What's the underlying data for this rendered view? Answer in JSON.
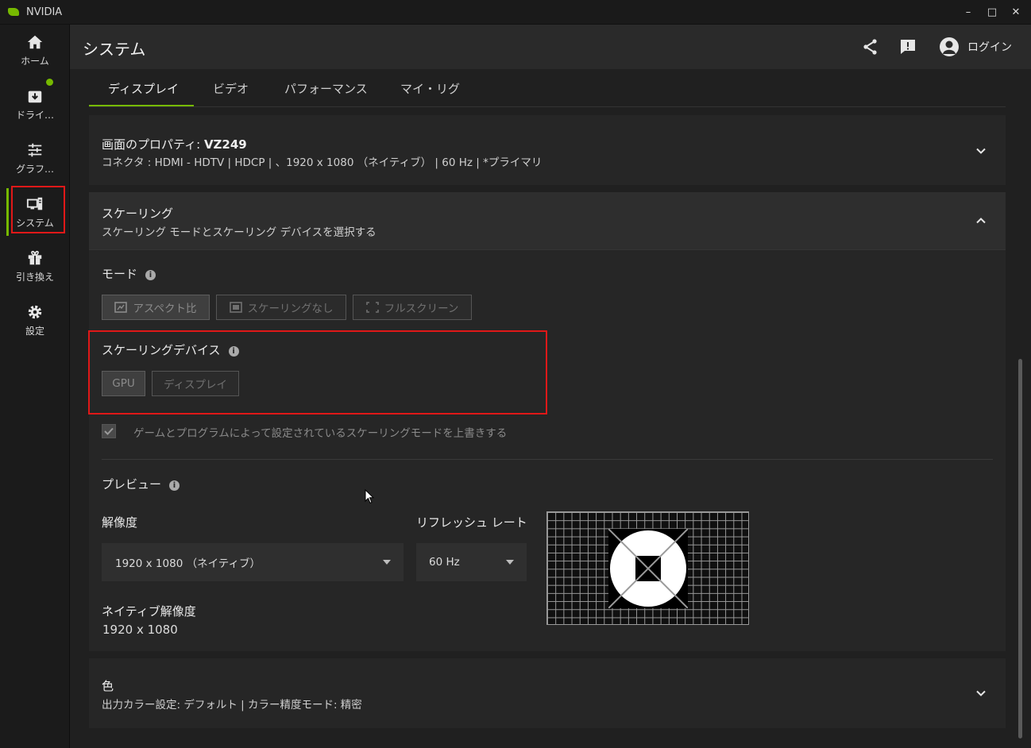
{
  "window": {
    "title": "NVIDIA",
    "minimize": "–",
    "maximize": "□",
    "close": "✕"
  },
  "nav": [
    {
      "label": "ホーム",
      "icon": "home-icon"
    },
    {
      "label": "ドライ…",
      "icon": "driver-download-icon"
    },
    {
      "label": "グラフ…",
      "icon": "sliders-icon"
    },
    {
      "label": "システム",
      "icon": "system-icon",
      "active": true
    },
    {
      "label": "引き換え",
      "icon": "gift-icon"
    },
    {
      "label": "設定",
      "icon": "gear-icon"
    }
  ],
  "header": {
    "title": "システム",
    "login": "ログイン"
  },
  "tabs": [
    "ディスプレイ",
    "ビデオ",
    "パフォーマンス",
    "マイ・リグ"
  ],
  "display_props": {
    "title_prefix": "画面のプロパティ: ",
    "monitor": "VZ249",
    "subtitle": "コネクタ : HDMI - HDTV | HDCP | 、1920 x 1080 （ネイティブ） | 60 Hz | *プライマリ"
  },
  "scaling": {
    "title": "スケーリング",
    "subtitle": "スケーリング モードとスケーリング デバイスを選択する",
    "mode_label": "モード",
    "modes": [
      "アスペクト比",
      "スケーリングなし",
      "フルスクリーン"
    ],
    "device_label": "スケーリングデバイス",
    "devices": [
      "GPU",
      "ディスプレイ"
    ],
    "override_label": "ゲームとプログラムによって設定されているスケーリングモードを上書きする",
    "preview_label": "プレビュー",
    "resolution_label": "解像度",
    "resolution_value": "1920 x 1080 （ネイティブ）",
    "refresh_label": "リフレッシュ レート",
    "refresh_value": "60 Hz",
    "native_label": "ネイティブ解像度",
    "native_value": "1920 x 1080"
  },
  "color": {
    "title": "色",
    "subtitle": "出力カラー設定: デフォルト | カラー精度モード: 精密"
  },
  "accent": "#76b900",
  "highlight": "#e01818"
}
